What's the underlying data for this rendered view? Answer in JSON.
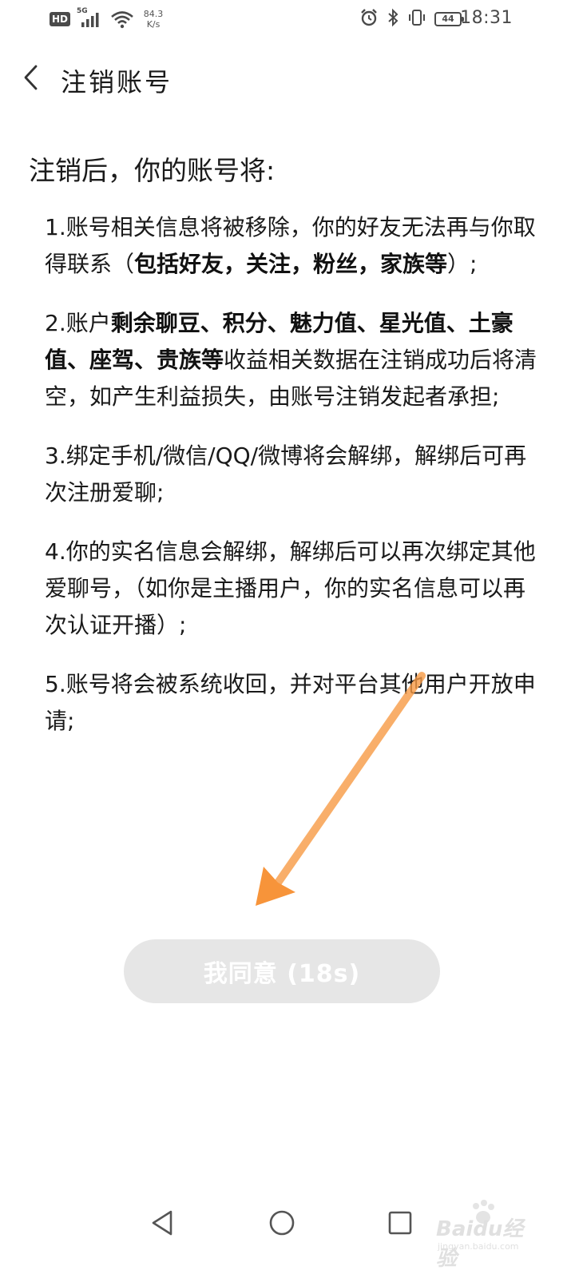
{
  "status_bar": {
    "hd_label": "HD",
    "network_gen": "5G",
    "speed_value": "84.3",
    "speed_unit": "K/s",
    "battery_level": "44",
    "time": "18:31",
    "icons": [
      "alarm-icon",
      "bluetooth-icon",
      "vibrate-icon",
      "battery-icon"
    ]
  },
  "header": {
    "back_icon": "chevron-left-icon",
    "title": "注销账号"
  },
  "main": {
    "intro": "注销后，你的账号将:",
    "rules": [
      {
        "parts": [
          {
            "t": "1.账号相关信息将被移除，你的好友无法再与你取得联系（",
            "b": false
          },
          {
            "t": "包括好友，关注，粉丝，家族等",
            "b": true
          },
          {
            "t": "）;",
            "b": false
          }
        ]
      },
      {
        "parts": [
          {
            "t": "2.账户",
            "b": false
          },
          {
            "t": "剩余聊豆、积分、魅力值、星光值、土豪值、座驾、贵族等",
            "b": true
          },
          {
            "t": "收益相关数据在注销成功后将清空，如产生利益损失，由账号注销发起者承担;",
            "b": false
          }
        ]
      },
      {
        "parts": [
          {
            "t": "3.绑定手机/微信/QQ/微博将会解绑，解绑后可再次注册爱聊;",
            "b": false
          }
        ]
      },
      {
        "parts": [
          {
            "t": "4.你的实名信息会解绑，解绑后可以再次绑定其他爱聊号，（如你是主播用户，你的实名信息可以再次认证开播）;",
            "b": false
          }
        ]
      },
      {
        "parts": [
          {
            "t": "5.账号将会被系统收回，并对平台其他用户开放申请;",
            "b": false
          }
        ]
      }
    ]
  },
  "agree_button": {
    "label": "我同意 (18s)",
    "countdown_seconds": 18,
    "enabled": false
  },
  "annotation": {
    "arrow_color": "#f7943a"
  },
  "nav_bar": {
    "icons": [
      "back-triangle-icon",
      "home-circle-icon",
      "recents-square-icon"
    ]
  },
  "watermark": {
    "text": "Baidu经验",
    "sub": "jingyan.baidu.com"
  }
}
